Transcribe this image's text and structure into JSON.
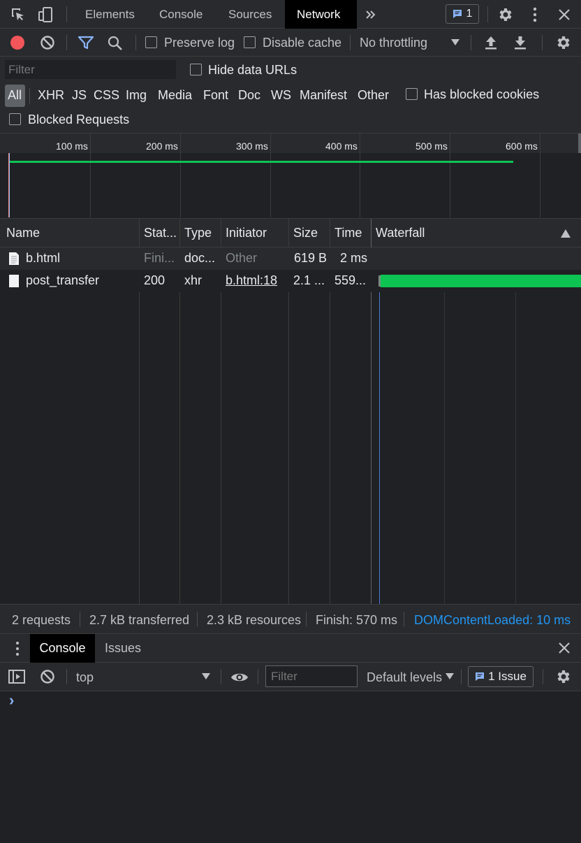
{
  "topbar": {
    "tabs": [
      "Elements",
      "Console",
      "Sources",
      "Network"
    ],
    "active_tab": "Network",
    "issues_count": "1",
    "icons": [
      "inspect-element-icon",
      "device-toolbar-icon",
      "more-tabs-icon",
      "settings-icon",
      "kebab-menu-icon",
      "close-icon"
    ]
  },
  "toolbar": {
    "preserve_log": "Preserve log",
    "disable_cache": "Disable cache",
    "throttling": "No throttling"
  },
  "filter": {
    "placeholder": "Filter",
    "hide_data_urls": "Hide data URLs",
    "types": [
      "All",
      "XHR",
      "JS",
      "CSS",
      "Img",
      "Media",
      "Font",
      "Doc",
      "WS",
      "Manifest",
      "Other"
    ],
    "active_type": "All",
    "has_blocked_cookies": "Has blocked cookies",
    "blocked_requests": "Blocked Requests"
  },
  "overview": {
    "ticks": [
      "100 ms",
      "200 ms",
      "300 ms",
      "400 ms",
      "500 ms",
      "600 ms"
    ]
  },
  "table": {
    "columns": [
      "Name",
      "Stat...",
      "Type",
      "Initiator",
      "Size",
      "Time",
      "Waterfall"
    ],
    "rows": [
      {
        "name": "b.html",
        "status": "Fini...",
        "type": "doc...",
        "initiator": "Other",
        "size": "619 B",
        "time": "2 ms"
      },
      {
        "name": "post_transfer",
        "status": "200",
        "type": "xhr",
        "initiator": "b.html:18",
        "size": "2.1 ...",
        "time": "559..."
      }
    ]
  },
  "status": {
    "requests": "2 requests",
    "transferred": "2.7 kB transferred",
    "resources": "2.3 kB resources",
    "finish": "Finish: 570 ms",
    "dcl": "DOMContentLoaded: 10 ms"
  },
  "drawer": {
    "tabs": [
      "Console",
      "Issues"
    ],
    "active_tab": "Console",
    "context": "top",
    "filter_placeholder": "Filter",
    "levels": "Default levels",
    "issues": "1 Issue",
    "prompt": "›"
  },
  "colors": {
    "accent_blue": "#8ab4f8",
    "record_red": "#f2555a",
    "waterfall_green": "#0dc453",
    "dcl_blue": "#2196f3"
  }
}
